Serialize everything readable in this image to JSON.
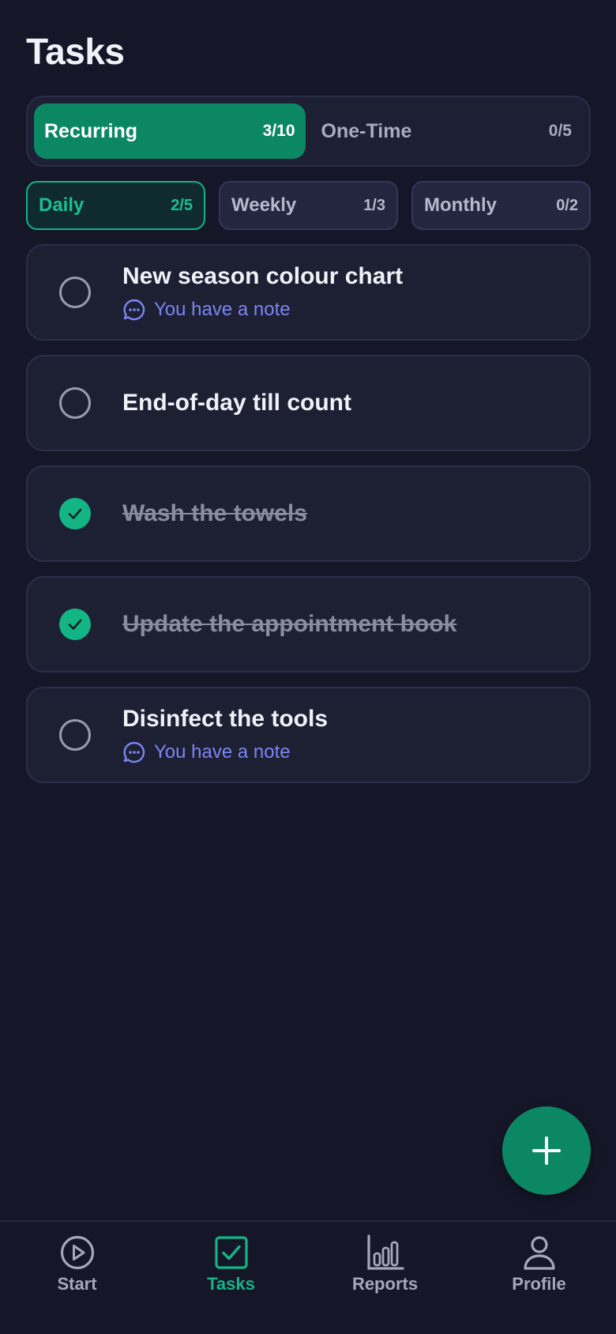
{
  "page": {
    "title": "Tasks"
  },
  "segments": [
    {
      "label": "Recurring",
      "count": "3/10",
      "active": true
    },
    {
      "label": "One-Time",
      "count": "0/5",
      "active": false
    }
  ],
  "periods": [
    {
      "label": "Daily",
      "count": "2/5",
      "active": true
    },
    {
      "label": "Weekly",
      "count": "1/3",
      "active": false
    },
    {
      "label": "Monthly",
      "count": "0/2",
      "active": false
    }
  ],
  "tasks": [
    {
      "title": "New season colour chart",
      "done": false,
      "note": "You have a note"
    },
    {
      "title": "End-of-day till count",
      "done": false,
      "note": ""
    },
    {
      "title": "Wash the towels",
      "done": true,
      "note": ""
    },
    {
      "title": "Update the appointment book",
      "done": true,
      "note": ""
    },
    {
      "title": "Disinfect the tools",
      "done": false,
      "note": "You have a note"
    }
  ],
  "fab": {
    "icon": "plus-icon"
  },
  "nav": [
    {
      "label": "Start",
      "icon": "play-circle-icon",
      "active": false
    },
    {
      "label": "Tasks",
      "icon": "checkbox-icon",
      "active": true
    },
    {
      "label": "Reports",
      "icon": "bar-chart-icon",
      "active": false
    },
    {
      "label": "Profile",
      "icon": "user-icon",
      "active": false
    }
  ],
  "colors": {
    "background": "#151729",
    "accent": "#0c8764",
    "accent_bright": "#15b486",
    "note": "#7b86f2"
  }
}
